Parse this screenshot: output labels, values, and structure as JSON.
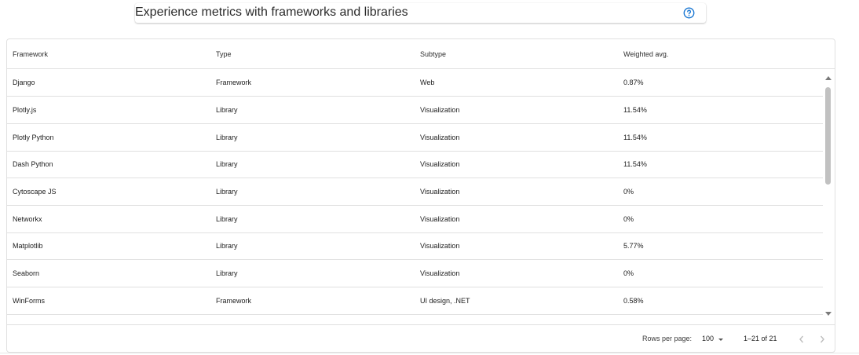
{
  "header": {
    "title": "Experience metrics with frameworks and libraries",
    "help_icon": "help-circle-icon"
  },
  "table": {
    "columns": [
      "Framework",
      "Type",
      "Subtype",
      "Weighted avg."
    ],
    "rows": [
      [
        "Django",
        "Framework",
        "Web",
        "0.87%"
      ],
      [
        "Plotly.js",
        "Library",
        "Visualization",
        "11.54%"
      ],
      [
        "Plotly Python",
        "Library",
        "Visualization",
        "11.54%"
      ],
      [
        "Dash Python",
        "Library",
        "Visualization",
        "11.54%"
      ],
      [
        "Cytoscape JS",
        "Library",
        "Visualization",
        "0%"
      ],
      [
        "Networkx",
        "Library",
        "Visualization",
        "0%"
      ],
      [
        "Matplotlib",
        "Library",
        "Visualization",
        "5.77%"
      ],
      [
        "Seaborn",
        "Library",
        "Visualization",
        "0%"
      ],
      [
        "WinForms",
        "Framework",
        "UI design, .NET",
        "0.58%"
      ]
    ]
  },
  "footer": {
    "rows_per_page_label": "Rows per page:",
    "rows_per_page_value": "100",
    "range_text": "1–21 of 21",
    "prev_icon": "chevron-left-icon",
    "next_icon": "chevron-right-icon"
  },
  "colors": {
    "accent": "#1976d2",
    "divider": "#e0e0e0",
    "scroll_thumb": "#c1c1c1"
  }
}
